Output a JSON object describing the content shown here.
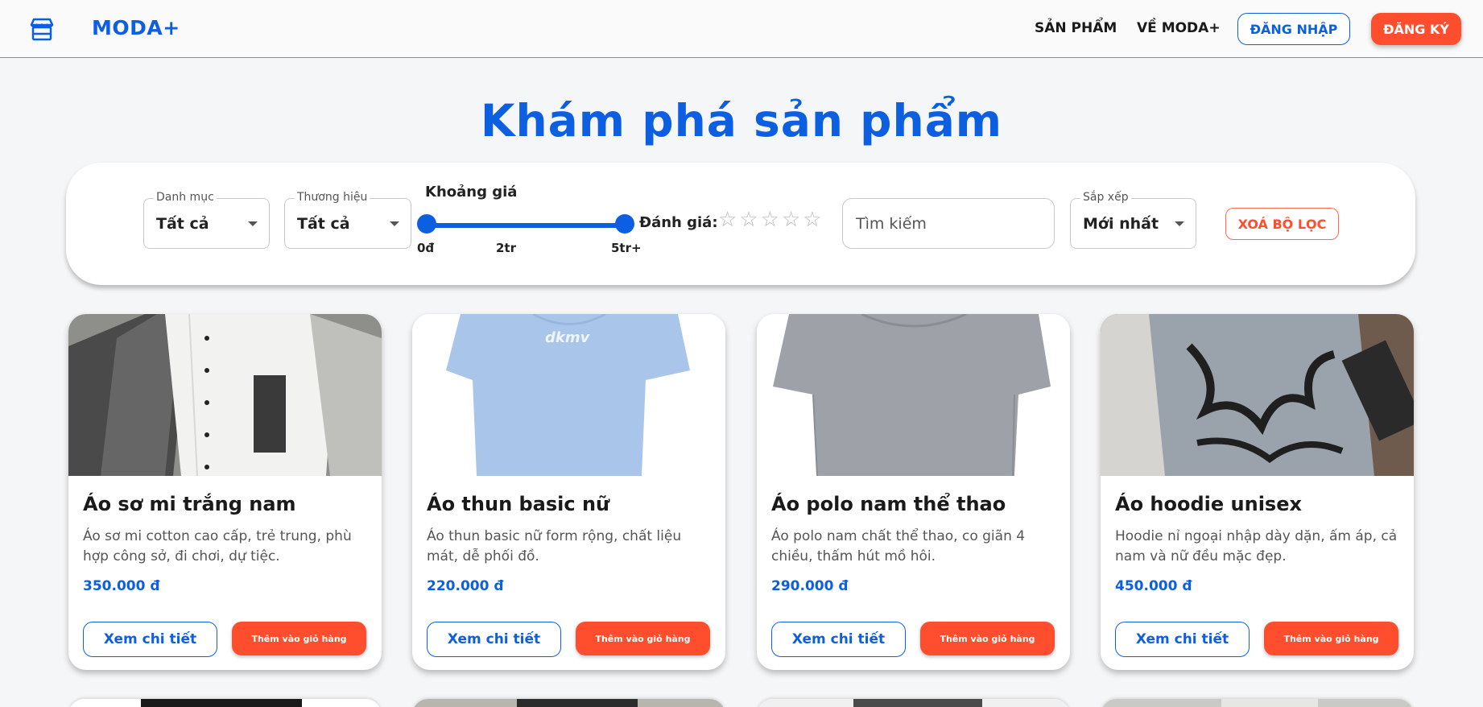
{
  "header": {
    "brand": "MODA+",
    "nav": [
      "SẢN PHẨM",
      "VỀ MODA+"
    ],
    "login_label": "ĐĂNG NHẬP",
    "register_label": "ĐĂNG KÝ",
    "logo_icon": "store-icon"
  },
  "page_title": "Khám phá sản phẩm",
  "filters": {
    "category": {
      "label": "Danh mục",
      "value": "Tất cả"
    },
    "brand": {
      "label": "Thương hiệu",
      "value": "Tất cả"
    },
    "price": {
      "label": "Khoảng giá",
      "marks": [
        "0đ",
        "2tr",
        "5tr+"
      ],
      "range_fraction": [
        0,
        1
      ]
    },
    "rating": {
      "label": "Đánh giá:",
      "stars_selected": 0,
      "stars_total": 5
    },
    "search": {
      "placeholder": "Tìm kiếm"
    },
    "sort": {
      "label": "Sắp xếp",
      "value": "Mới nhất"
    },
    "clear_label": "XOÁ BỘ LỌC"
  },
  "products": [
    {
      "name": "Áo sơ mi trắng nam",
      "description": "Áo sơ mi cotton cao cấp, trẻ trung, phù hợp công sở, đi chơi, dự tiệc.",
      "price": "350.000 đ",
      "detail_label": "Xem chi tiết",
      "cart_label": "Thêm vào giỏ hàng"
    },
    {
      "name": "Áo thun basic nữ",
      "description": "Áo thun basic nữ form rộng, chất liệu mát, dễ phối đồ.",
      "price": "220.000 đ",
      "detail_label": "Xem chi tiết",
      "cart_label": "Thêm vào giỏ hàng"
    },
    {
      "name": "Áo polo nam thể thao",
      "description": "Áo polo nam chất thể thao, co giãn 4 chiều, thấm hút mồ hôi.",
      "price": "290.000 đ",
      "detail_label": "Xem chi tiết",
      "cart_label": "Thêm vào giỏ hàng"
    },
    {
      "name": "Áo hoodie unisex",
      "description": "Hoodie nỉ ngoại nhập dày dặn, ấm áp, cả nam và nữ đều mặc đẹp.",
      "price": "450.000 đ",
      "detail_label": "Xem chi tiết",
      "cart_label": "Thêm vào giỏ hàng"
    }
  ],
  "colors": {
    "primary": "#0d5fe2",
    "accent": "#ff4e2e"
  }
}
